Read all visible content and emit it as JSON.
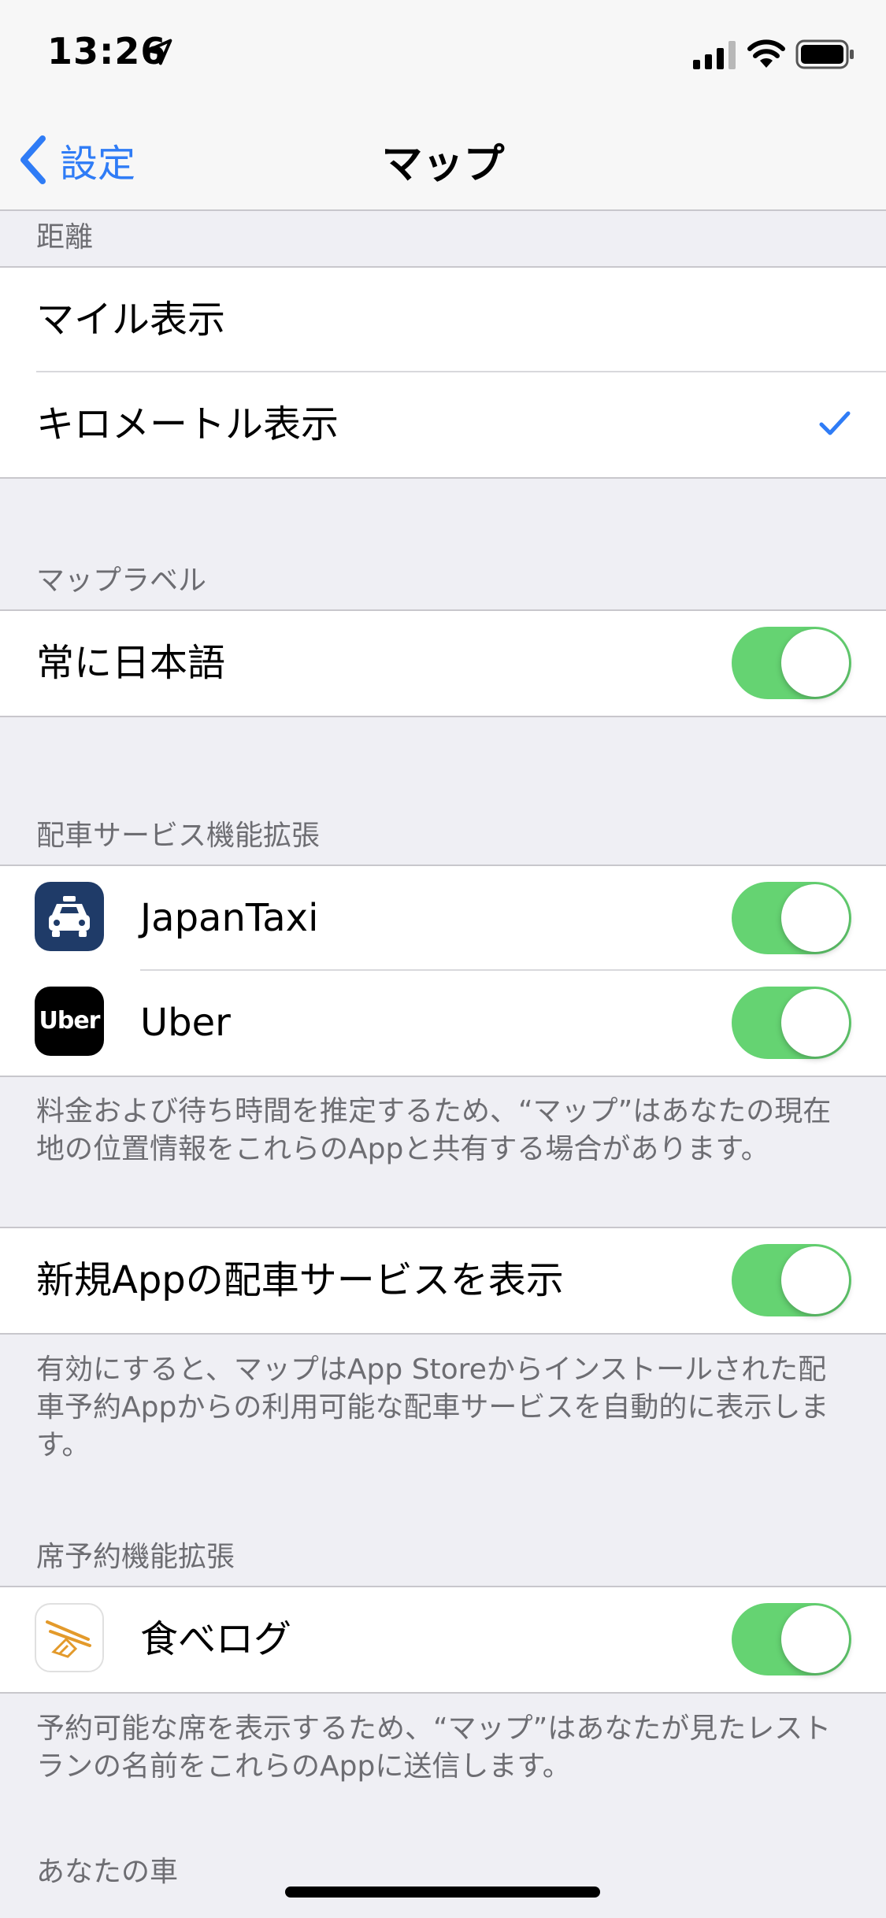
{
  "status_bar": {
    "time": "13:26"
  },
  "nav": {
    "back_label": "設定",
    "title": "マップ"
  },
  "distance": {
    "header": "距離",
    "options": [
      {
        "label": "マイル表示",
        "selected": false
      },
      {
        "label": "キロメートル表示",
        "selected": true
      }
    ]
  },
  "map_labels": {
    "header": "マップラベル",
    "always_japanese": {
      "label": "常に日本語",
      "on": true
    }
  },
  "ride_extensions": {
    "header": "配車サービス機能拡張",
    "apps": [
      {
        "label": "JapanTaxi",
        "icon": "taxi-icon",
        "on": true
      },
      {
        "label": "Uber",
        "icon_text": "Uber",
        "on": true
      }
    ],
    "footer_line1": "料金および待ち時間を推定するため、“マップ”はあなたの現在",
    "footer_line2": "地の位置情報をこれらのAppと共有する場合があります。"
  },
  "new_app_ride": {
    "label": "新規Appの配車サービスを表示",
    "on": true,
    "footer_line1": "有効にすると、マップはApp Storeからインストールされた配",
    "footer_line2": "車予約Appからの利用可能な配車サービスを自動的に表示しま",
    "footer_line3": "す。"
  },
  "seat_reservation": {
    "header": "席予約機能拡張",
    "app": {
      "label": "食べログ",
      "icon": "tabelog-icon",
      "on": true
    },
    "footer_line1": "予約可能な席を表示するため、“マップ”はあなたが見たレスト",
    "footer_line2": "ランの名前をこれらのAppに送信します。"
  },
  "your_car": {
    "header": "あなたの車"
  },
  "colors": {
    "accent": "#2f7cf6",
    "toggle_on": "#65d372",
    "background": "#efeff4"
  }
}
